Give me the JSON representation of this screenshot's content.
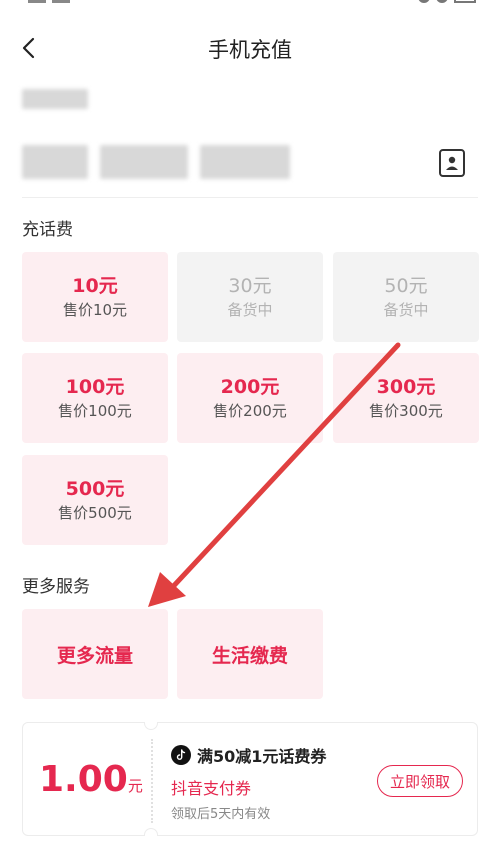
{
  "header": {
    "title": "手机充值"
  },
  "recharge": {
    "section_title": "充话费",
    "tiles": [
      {
        "amount": "10元",
        "sub": "售价10元"
      },
      {
        "amount": "30元",
        "sub": "备货中"
      },
      {
        "amount": "50元",
        "sub": "备货中"
      },
      {
        "amount": "100元",
        "sub": "售价100元"
      },
      {
        "amount": "200元",
        "sub": "售价200元"
      },
      {
        "amount": "300元",
        "sub": "售价300元"
      },
      {
        "amount": "500元",
        "sub": "售价500元"
      }
    ]
  },
  "services": {
    "section_title": "更多服务",
    "items": [
      {
        "label": "更多流量"
      },
      {
        "label": "生活缴费"
      }
    ]
  },
  "coupon": {
    "price_value": "1.00",
    "price_unit": "元",
    "title": "满50减1元话费券",
    "subtitle": "抖音支付券",
    "note": "领取后5天内有效",
    "claim_label": "立即领取"
  },
  "colors": {
    "accent": "#e5284f",
    "tile_bg": "#fdeef1",
    "disabled_bg": "#f3f3f3",
    "annotation_arrow": "#e04040"
  },
  "icons": {
    "back": "chevron-left-icon",
    "contacts": "contact-book-icon",
    "brand": "tiktok-icon"
  }
}
